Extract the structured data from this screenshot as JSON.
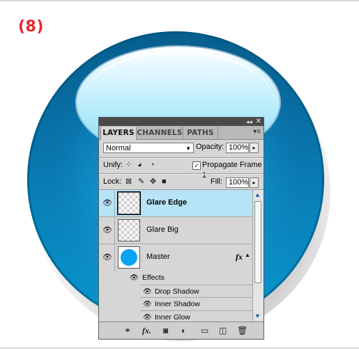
{
  "step_label": "(8)",
  "colors": {
    "step_label": "#e8262a",
    "orb_blue": "#0f8ec7",
    "glare": "#b8ecfb",
    "selected_row": "#b7e3f7",
    "master_thumb": "#0aa3f4"
  },
  "panel": {
    "titlebar": {
      "collapse_icon": "collapse-arrows-icon",
      "close_icon": "close-icon",
      "collapse_glyph": "◂◂",
      "close_glyph": "✕"
    },
    "tabs": [
      {
        "label": "LAYERS",
        "active": true
      },
      {
        "label": "CHANNELS",
        "active": false
      },
      {
        "label": "PATHS",
        "active": false
      }
    ],
    "menu_glyph": "▾≡",
    "blend_mode": {
      "value": "Normal",
      "arrow": "▼"
    },
    "opacity": {
      "label": "Opacity:",
      "value": "100%",
      "stepper": "▸"
    },
    "unify": {
      "label": "Unify:",
      "icons": [
        "unify-position-icon",
        "unify-visibility-icon",
        "unify-style-icon"
      ]
    },
    "propagate": {
      "label": "Propagate Frame 1",
      "checked": true,
      "check_glyph": "✓"
    },
    "lock": {
      "label": "Lock:",
      "icons": [
        "lock-transparent-icon",
        "lock-image-icon",
        "lock-position-icon",
        "lock-all-icon"
      ]
    },
    "fill": {
      "label": "Fill:",
      "value": "100%",
      "stepper": "▸"
    },
    "layers": [
      {
        "name": "Glare Edge",
        "selected": true,
        "visible": true,
        "thumb": "transparent"
      },
      {
        "name": "Glare Big",
        "selected": false,
        "visible": true,
        "thumb": "transparent"
      },
      {
        "name": "Master",
        "selected": false,
        "visible": true,
        "thumb": "blue-circle",
        "fx": "fx",
        "fx_arrow": "▲"
      }
    ],
    "effects": {
      "label": "Effects",
      "items": [
        "Drop Shadow",
        "Inner Shadow",
        "Inner Glow"
      ]
    },
    "eye_glyph": "👁",
    "scroll": {
      "up": "▲",
      "down": "▼"
    },
    "bottom_icons": [
      "link-layers-icon",
      "add-style-icon",
      "add-mask-icon",
      "adjustment-layer-icon",
      "new-group-icon",
      "new-layer-icon",
      "delete-icon"
    ],
    "fx_bottom": "fx."
  }
}
